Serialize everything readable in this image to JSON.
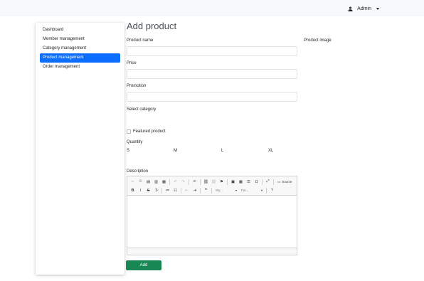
{
  "header": {
    "user_label": "Admin"
  },
  "sidebar": {
    "items": [
      {
        "label": "Dashboard"
      },
      {
        "label": "Member management"
      },
      {
        "label": "Category management"
      },
      {
        "label": "Product management",
        "active": true
      },
      {
        "label": "Order management"
      }
    ]
  },
  "main": {
    "title": "Add product",
    "product_name_label": "Product name",
    "product_image_label": "Product image",
    "price_label": "Price",
    "promotion_label": "Promotion",
    "select_category_label": "Select category",
    "featured_label": "Featured product",
    "quantity_label": "Quantity",
    "sizes": [
      "S",
      "M",
      "L",
      "XL"
    ],
    "description_label": "Description",
    "editor": {
      "source_label": "Source",
      "styles_placeholder": "Sty...",
      "format_placeholder": "For...",
      "help_label": "?"
    },
    "add_button": "Add"
  },
  "colors": {
    "primary": "#0d6efd",
    "success": "#198754",
    "topbar": "#f8f9fa"
  }
}
